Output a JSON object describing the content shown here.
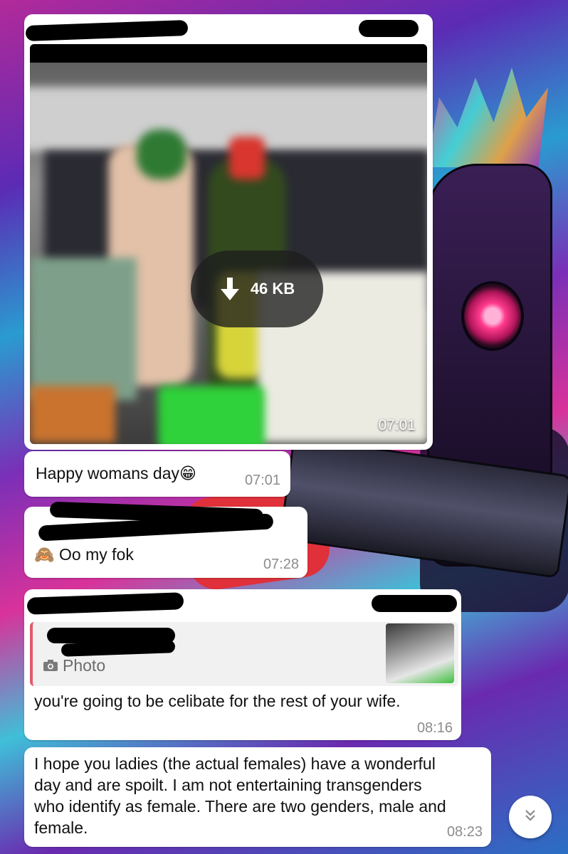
{
  "messages": {
    "image": {
      "download_size": "46 KB",
      "time": "07:01"
    },
    "caption": {
      "text": "Happy womans day",
      "emoji": "😁",
      "time": "07:01"
    },
    "monkey": {
      "emoji": "🙈",
      "text": "Oo my fok",
      "time": "07:28"
    },
    "reply": {
      "quoted_label": "Photo",
      "text": "you're going to be celibate for the rest of your wife.",
      "time": "08:16"
    },
    "final": {
      "text": "I hope you ladies (the actual females) have a wonderful day and are spoilt.  I am not entertaining transgenders who identify as female. There are two genders, male and female.",
      "time": "08:23"
    }
  },
  "icons": {
    "download": "download-arrow-icon",
    "camera": "camera-icon",
    "scroll_down": "double-chevron-down-icon"
  },
  "colors": {
    "bubble": "#ffffff",
    "quote_accent": "#e05b6c",
    "timestamp": "#8c8c8c"
  }
}
